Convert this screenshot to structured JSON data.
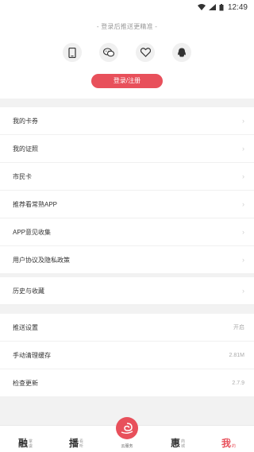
{
  "status_bar": {
    "time": "12:49"
  },
  "header": {
    "login_hint": "- 登录后推送更精准 -",
    "login_button": "登录/注册",
    "login_icons": [
      "phone-icon",
      "wechat-icon",
      "heart-icon",
      "qq-icon"
    ]
  },
  "menu_group1": [
    {
      "label": "我的卡券"
    },
    {
      "label": "我的证照"
    },
    {
      "label": "市民卡"
    },
    {
      "label": "推荐看常熟APP"
    },
    {
      "label": "APP意见收集"
    },
    {
      "label": "用户协议及隐私政策"
    }
  ],
  "menu_group2": [
    {
      "label": "历史与收藏"
    }
  ],
  "menu_group3": [
    {
      "label": "推送设置",
      "value": "开启"
    },
    {
      "label": "手动清理缓存",
      "value": "2.81M"
    },
    {
      "label": "检查更新",
      "value": "2.7.9"
    }
  ],
  "bottom_nav": {
    "items": [
      {
        "main": "融",
        "sub1": "掌",
        "sub2": "虞"
      },
      {
        "main": "播",
        "sub1": "看",
        "sub2": "听"
      },
      {
        "center_label": "云服务"
      },
      {
        "main": "惠",
        "sub1": "商",
        "sub2": "城"
      },
      {
        "main": "我",
        "sub1": "的",
        "sub2": ""
      }
    ]
  },
  "colors": {
    "accent": "#e8505b",
    "background": "#f2f2f2"
  }
}
